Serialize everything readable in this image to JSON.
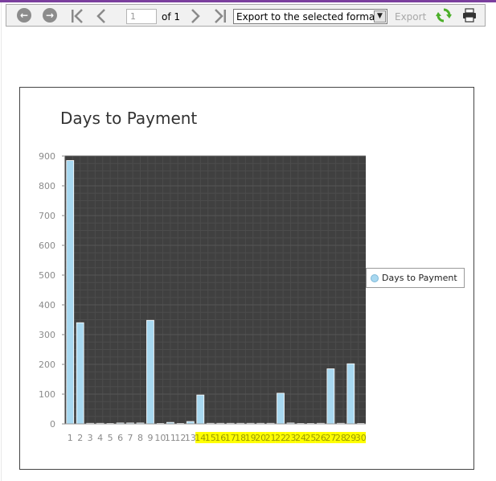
{
  "toolbar": {
    "first_page_icon": "skip-to-first-icon",
    "prev_icon": "chevron-left-icon",
    "next_icon": "chevron-right-icon",
    "last_page_icon": "skip-to-last-icon",
    "back_icon": "arrow-left-circle-icon",
    "forward_icon": "arrow-right-circle-icon",
    "page_input_value": "1",
    "page_of": "of 1",
    "export_select": "Export to the selected format",
    "export_label": "Export",
    "refresh_icon": "refresh-icon",
    "print_icon": "print-icon"
  },
  "colors": {
    "plot_background": "#404040",
    "bar_fill": "#a8d8f0",
    "highlight": "#ffff00",
    "accent": "#7b3f9e"
  },
  "chart_data": {
    "type": "bar",
    "title": "Days to Payment",
    "xlabel": "",
    "ylabel": "",
    "ylim": [
      0,
      900
    ],
    "yticks": [
      "0",
      "100",
      "200",
      "300",
      "400",
      "500",
      "600",
      "700",
      "800",
      "900"
    ],
    "categories": [
      "1",
      "2",
      "3",
      "4",
      "5",
      "6",
      "7",
      "8",
      "9",
      "10",
      "11",
      "12",
      "13",
      "14",
      "15",
      "16",
      "17",
      "18",
      "19",
      "20",
      "21",
      "22",
      "23",
      "24",
      "25",
      "26",
      "27",
      "28",
      "29",
      "30"
    ],
    "highlighted_categories": [
      "14",
      "15",
      "16",
      "17",
      "18",
      "19",
      "20",
      "21",
      "22",
      "23",
      "24",
      "25",
      "26",
      "27",
      "28",
      "29",
      "30"
    ],
    "series": [
      {
        "name": "Days to Payment",
        "values": [
          885,
          340,
          2,
          2,
          0,
          3,
          3,
          3,
          348,
          0,
          5,
          0,
          8,
          97,
          2,
          2,
          2,
          2,
          2,
          2,
          2,
          103,
          3,
          0,
          0,
          2,
          185,
          2,
          202,
          0
        ]
      }
    ],
    "grid": true,
    "legend_position": "right"
  }
}
